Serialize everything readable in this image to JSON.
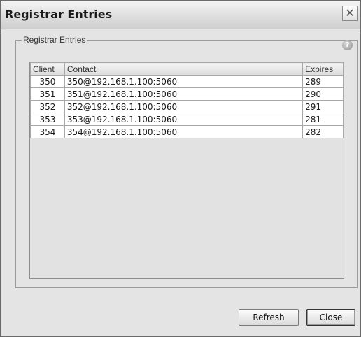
{
  "window": {
    "title": "Registrar Entries",
    "close_glyph": "✕"
  },
  "group": {
    "label": "Registrar Entries",
    "help_glyph": "?"
  },
  "table": {
    "headers": [
      "Client",
      "Contact",
      "Expires"
    ],
    "rows": [
      {
        "client": "350",
        "contact": "350@192.168.1.100:5060",
        "expires": "289"
      },
      {
        "client": "351",
        "contact": "351@192.168.1.100:5060",
        "expires": "290"
      },
      {
        "client": "352",
        "contact": "352@192.168.1.100:5060",
        "expires": "291"
      },
      {
        "client": "353",
        "contact": "353@192.168.1.100:5060",
        "expires": "281"
      },
      {
        "client": "354",
        "contact": "354@192.168.1.100:5060",
        "expires": "282"
      }
    ]
  },
  "buttons": {
    "refresh": "Refresh",
    "close": "Close"
  }
}
